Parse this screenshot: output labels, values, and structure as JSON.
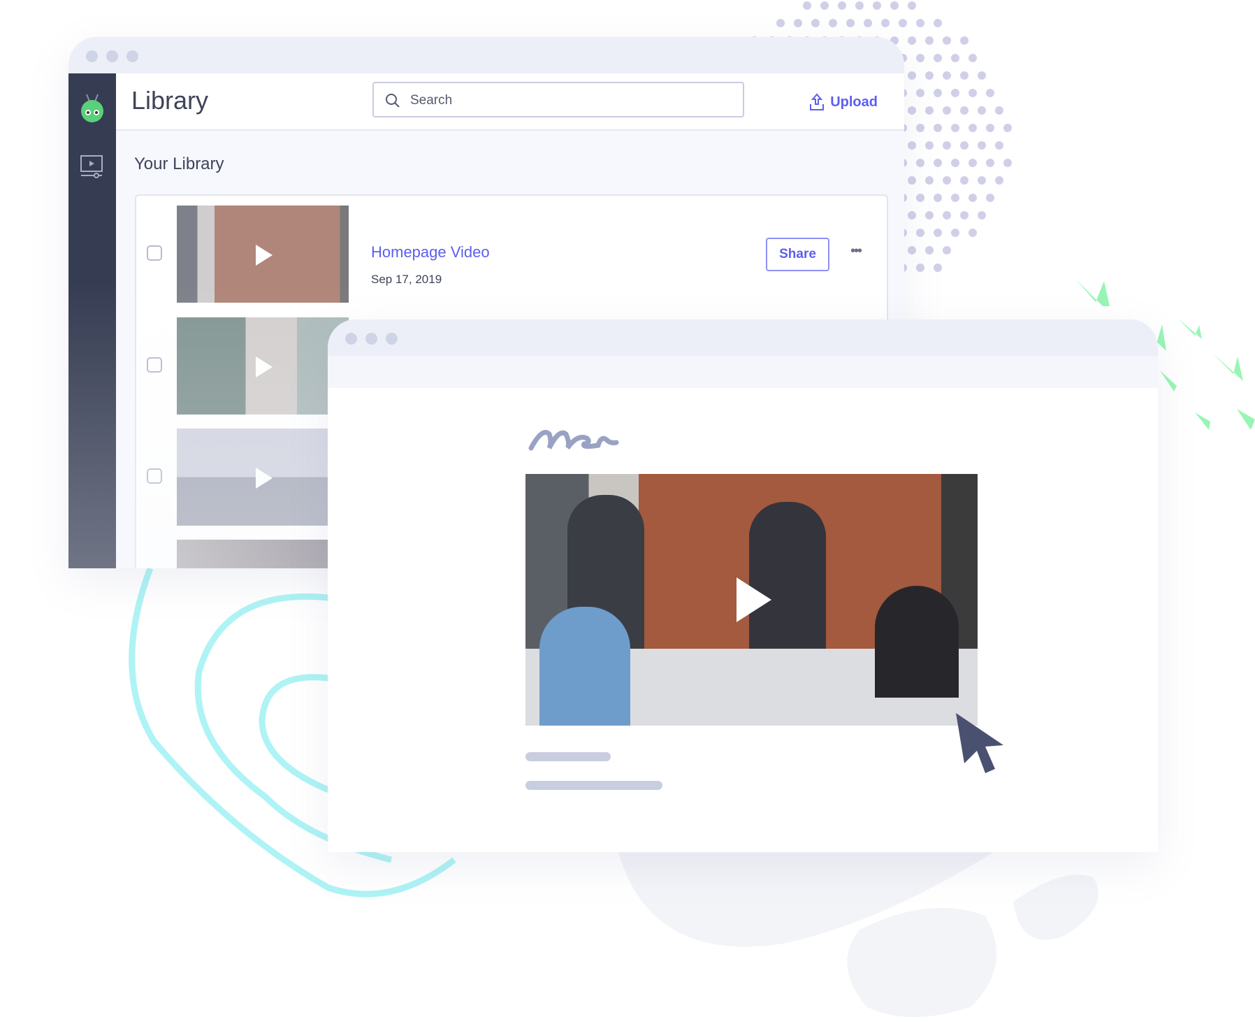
{
  "library_window": {
    "title": "Library",
    "search": {
      "placeholder": "Search",
      "value": ""
    },
    "upload_label": "Upload",
    "section_title": "Your Library",
    "videos": [
      {
        "title": "Homepage Video",
        "date": "Sep 17, 2019",
        "share_label": "Share",
        "more_label": "•••"
      },
      {
        "title": "",
        "date": ""
      },
      {
        "title": "",
        "date": ""
      },
      {
        "title": "",
        "date": ""
      }
    ],
    "sidebar": [
      "logo-icon",
      "video-library-icon"
    ]
  },
  "preview_window": {
    "signature": "scribble",
    "video": "team-office-video"
  },
  "colors": {
    "accent": "#5b5ff0",
    "sidebar": "#363c52",
    "dots": "#cfd0e8",
    "green": "#98f5b4",
    "cyan": "#aef3f5",
    "cursor": "#4a5170"
  }
}
